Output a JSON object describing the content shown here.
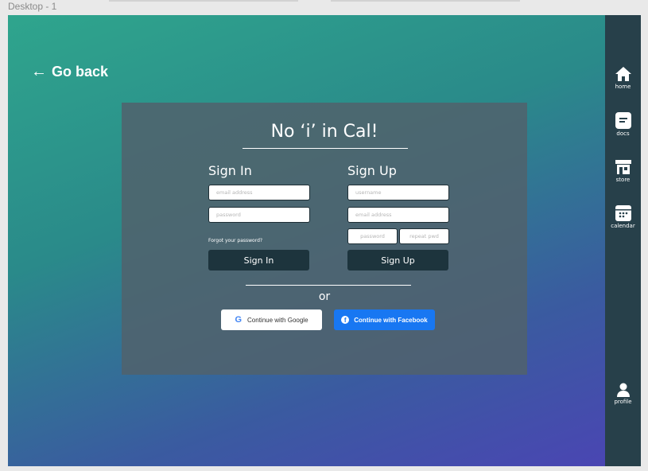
{
  "frame_label": "Desktop - 1",
  "go_back": {
    "label": "Go back",
    "arrow": "←"
  },
  "card": {
    "title": "No ‘i’ in Cal!",
    "signin": {
      "title": "Sign In",
      "email_placeholder": "email address",
      "password_placeholder": "password",
      "forgot": "Forgot your password?",
      "button": "Sign In"
    },
    "signup": {
      "title": "Sign Up",
      "username_placeholder": "username",
      "email_placeholder": "email address",
      "password_placeholder": "password",
      "repeat_placeholder": "repeat pwd",
      "button": "Sign Up"
    },
    "or": "or",
    "google": "Continue with Google",
    "facebook": "Continue with Facebook"
  },
  "sidebar": {
    "items": [
      {
        "label": "home",
        "icon": "home-icon"
      },
      {
        "label": "docs",
        "icon": "docs-icon"
      },
      {
        "label": "store",
        "icon": "store-icon"
      },
      {
        "label": "calendar",
        "icon": "calendar-icon"
      },
      {
        "label": "profile",
        "icon": "profile-icon"
      }
    ]
  },
  "colors": {
    "sidebar": "#27404a",
    "button_dark": "#1d343d",
    "facebook": "#1877f2"
  }
}
